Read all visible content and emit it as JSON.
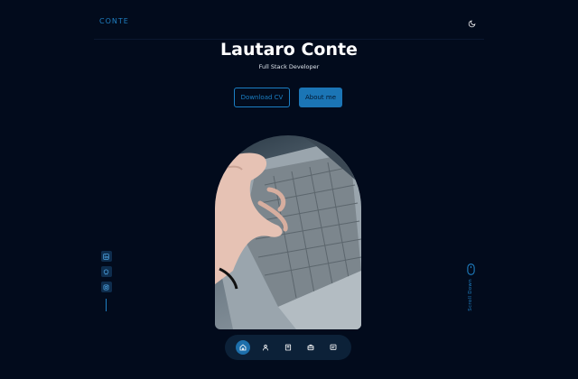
{
  "header": {
    "logo": "CONTE",
    "theme_icon": "moon-icon"
  },
  "hero": {
    "title": "Lautaro Conte",
    "subtitle": "Full Stack Developer",
    "download_cv_label": "Download CV",
    "about_me_label": "About me"
  },
  "socials": [
    {
      "icon": "linkedin-icon"
    },
    {
      "icon": "github-icon"
    },
    {
      "icon": "instagram-icon"
    }
  ],
  "scroll": {
    "label": "Scroll Down",
    "icon": "mouse-icon"
  },
  "nav": [
    {
      "icon": "home-icon",
      "active": true
    },
    {
      "icon": "user-icon",
      "active": false
    },
    {
      "icon": "book-icon",
      "active": false
    },
    {
      "icon": "briefcase-icon",
      "active": false
    },
    {
      "icon": "message-icon",
      "active": false
    }
  ],
  "colors": {
    "background": "#020b1c",
    "accent": "#1b7fc4",
    "nav_bg": "#0c2138"
  }
}
